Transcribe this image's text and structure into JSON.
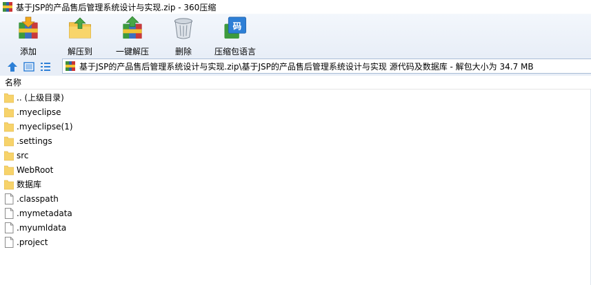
{
  "window": {
    "title": "基于JSP的产品售后管理系统设计与实现.zip - 360压缩"
  },
  "toolbar": {
    "add": "添加",
    "extract_to": "解压到",
    "one_click_extract": "一键解压",
    "delete": "删除",
    "compress_lang": "压缩包语言"
  },
  "navbar": {
    "address": "基于JSP的产品售后管理系统设计与实现.zip\\基于JSP的产品售后管理系统设计与实现 源代码及数据库 - 解包大小为 34.7 MB"
  },
  "list": {
    "column_name": "名称",
    "items": [
      {
        "name": ".. (上级目录)",
        "type": "folder"
      },
      {
        "name": ".myeclipse",
        "type": "folder"
      },
      {
        "name": ".myeclipse(1)",
        "type": "folder"
      },
      {
        "name": ".settings",
        "type": "folder"
      },
      {
        "name": "src",
        "type": "folder"
      },
      {
        "name": "WebRoot",
        "type": "folder"
      },
      {
        "name": "数据库",
        "type": "folder"
      },
      {
        "name": ".classpath",
        "type": "file"
      },
      {
        "name": ".mymetadata",
        "type": "file"
      },
      {
        "name": ".myumldata",
        "type": "file"
      },
      {
        "name": ".project",
        "type": "file"
      }
    ]
  },
  "colors": {
    "toolbar_bg": "#e8eef7",
    "folder": "#f7d36b",
    "accent": "#2d7fd6"
  }
}
